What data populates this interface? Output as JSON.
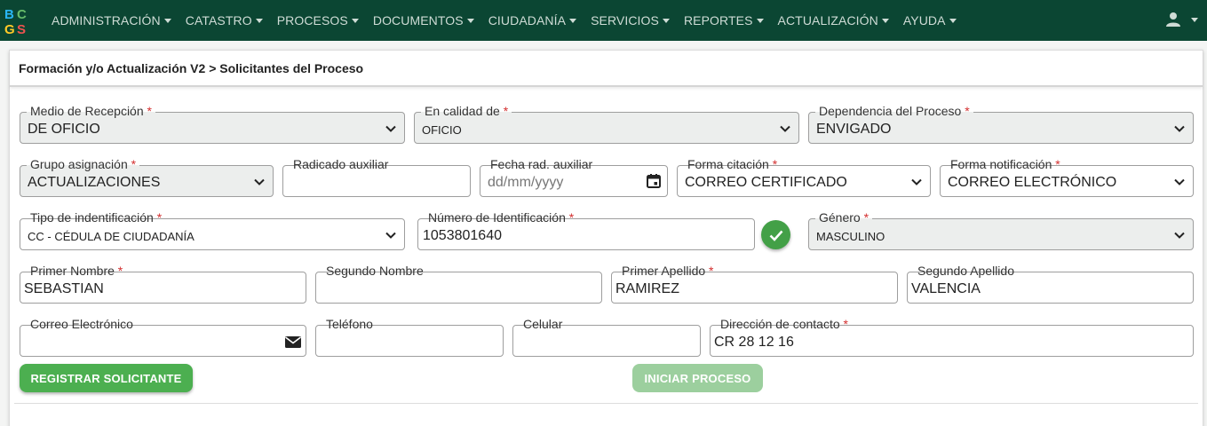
{
  "app": {
    "logo_text": "BCGS",
    "brand_colors": {
      "navbar": "#0b4633",
      "primary": "#4caf50",
      "required": "#d32f2f"
    }
  },
  "nav": {
    "items": [
      {
        "label": "ADMINISTRACIÓN"
      },
      {
        "label": "CATASTRO"
      },
      {
        "label": "PROCESOS"
      },
      {
        "label": "DOCUMENTOS"
      },
      {
        "label": "CIUDADANÍA"
      },
      {
        "label": "SERVICIOS"
      },
      {
        "label": "REPORTES"
      },
      {
        "label": "ACTUALIZACIÓN"
      },
      {
        "label": "AYUDA"
      }
    ],
    "user_icon": "user-icon"
  },
  "page": {
    "breadcrumb": "Formación y/o Actualización V2 > Solicitantes del Proceso"
  },
  "form": {
    "medio_recepcion": {
      "label": "Medio de Recepción",
      "value": "DE OFICIO"
    },
    "en_calidad_de": {
      "label": "En calidad de",
      "value": "OFICIO"
    },
    "dependencia": {
      "label": "Dependencia del Proceso",
      "value": "ENVIGADO"
    },
    "grupo_asignacion": {
      "label": "Grupo asignación",
      "value": "ACTUALIZACIONES"
    },
    "radicado_auxiliar": {
      "label": "Radicado auxiliar",
      "value": ""
    },
    "fecha_rad_auxiliar": {
      "label": "Fecha rad. auxiliar",
      "placeholder": "dd/mm/yyyy"
    },
    "forma_citacion": {
      "label": "Forma citación",
      "value": "CORREO CERTIFICADO"
    },
    "forma_notificacion": {
      "label": "Forma notificación",
      "value": "CORREO ELECTRÓNICO"
    },
    "tipo_identificacion": {
      "label": "Tipo de indentificación",
      "value": "CC - CÉDULA DE CIUDADANÍA"
    },
    "numero_identificacion": {
      "label": "Número de Identificación",
      "value": "1053801640"
    },
    "genero": {
      "label": "Género",
      "value": "MASCULINO"
    },
    "primer_nombre": {
      "label": "Primer Nombre",
      "value": "SEBASTIAN"
    },
    "segundo_nombre": {
      "label": "Segundo Nombre",
      "value": ""
    },
    "primer_apellido": {
      "label": "Primer Apellido",
      "value": "RAMIREZ"
    },
    "segundo_apellido": {
      "label": "Segundo Apellido",
      "value": "VALENCIA"
    },
    "correo": {
      "label": "Correo Electrónico",
      "value": ""
    },
    "telefono": {
      "label": "Teléfono",
      "value": ""
    },
    "celular": {
      "label": "Celular",
      "value": ""
    },
    "direccion": {
      "label": "Dirección de contacto",
      "value": "CR 28 12 16"
    },
    "required_mark": "*"
  },
  "actions": {
    "registrar": "REGISTRAR SOLICITANTE",
    "iniciar": "INICIAR PROCESO"
  }
}
